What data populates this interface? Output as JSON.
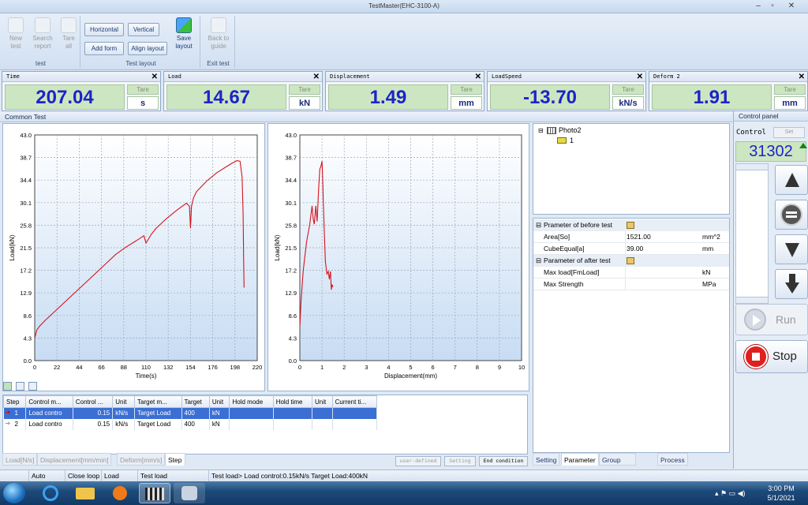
{
  "window": {
    "title": "TestMaster(EHC-3100-A)"
  },
  "ribbon": {
    "test_group": {
      "label": "test",
      "new_test": "New\ntest",
      "search_report": "Search\nreport",
      "tare_all": "Tare\nall"
    },
    "layout_group": {
      "label": "Test layout",
      "horizontal": "Horizontal",
      "vertical": "Vertical",
      "add_form": "Add form",
      "align_layout": "Align layout",
      "save_layout": "Save\nlayout"
    },
    "exit_group": {
      "label": "Exit test",
      "back_to_guide": "Back to\nguide"
    }
  },
  "meters": [
    {
      "title": "Time",
      "value": "207.04",
      "tare": "Tare",
      "unit": "s"
    },
    {
      "title": "Load",
      "value": "14.67",
      "tare": "Tare",
      "unit": "kN"
    },
    {
      "title": "Displacement",
      "value": "1.49",
      "tare": "Tare",
      "unit": "mm"
    },
    {
      "title": "LoadSpeed",
      "value": "-13.70",
      "tare": "Tare",
      "unit": "kN/s"
    },
    {
      "title": "Deform 2",
      "value": "1.91",
      "tare": "Tare",
      "unit": "mm"
    }
  ],
  "common_test": {
    "title": "Common Test"
  },
  "chart_data": [
    {
      "type": "line",
      "xlabel": "Time(s)",
      "ylabel": "Load(kN)",
      "xlim": [
        0,
        220
      ],
      "ylim": [
        0,
        43
      ],
      "xticks": [
        "0",
        "22",
        "44",
        "66",
        "88",
        "110",
        "132",
        "154",
        "176",
        "198",
        "220"
      ],
      "yticks": [
        "0.0",
        "4.3",
        "8.6",
        "12.9",
        "17.2",
        "21.5",
        "25.8",
        "30.1",
        "34.4",
        "38.7",
        "43.0"
      ],
      "grid": true,
      "series": [
        {
          "color": "#d4141c",
          "x": [
            0,
            2,
            5,
            10,
            20,
            30,
            40,
            50,
            60,
            70,
            80,
            90,
            100,
            108,
            110,
            112,
            115,
            120,
            130,
            140,
            150,
            153,
            154,
            155,
            157,
            160,
            170,
            180,
            190,
            195,
            198,
            200,
            203,
            205,
            206,
            206.5,
            207
          ],
          "y": [
            4.3,
            5.8,
            6.6,
            7.6,
            9.4,
            11.2,
            13.0,
            14.8,
            16.6,
            18.4,
            20.2,
            21.6,
            22.8,
            23.8,
            22.4,
            23.0,
            24.0,
            25.2,
            27.0,
            28.6,
            30.0,
            29.4,
            25.2,
            29.4,
            31.0,
            32.2,
            34.2,
            35.8,
            37.0,
            37.6,
            37.9,
            38.1,
            38.0,
            35.0,
            28.0,
            20.0,
            13.9
          ]
        }
      ]
    },
    {
      "type": "line",
      "xlabel": "Displacement(mm)",
      "ylabel": "Load(kN)",
      "xlim": [
        0,
        10
      ],
      "ylim": [
        0,
        43
      ],
      "xticks": [
        "0",
        "1",
        "2",
        "3",
        "4",
        "5",
        "6",
        "7",
        "8",
        "9",
        "10"
      ],
      "yticks": [
        "0.0",
        "4.3",
        "8.6",
        "12.9",
        "17.2",
        "21.5",
        "25.8",
        "30.1",
        "34.4",
        "38.7",
        "43.0"
      ],
      "grid": true,
      "series": [
        {
          "color": "#d4141c",
          "x": [
            0.0,
            0.05,
            0.15,
            0.3,
            0.45,
            0.55,
            0.6,
            0.65,
            0.72,
            0.78,
            0.85,
            0.9,
            0.95,
            1.0,
            1.03,
            1.06,
            1.1,
            1.15,
            1.22,
            1.28,
            1.33,
            1.38,
            1.42,
            1.45,
            1.49
          ],
          "y": [
            6.5,
            11.0,
            17.0,
            22.5,
            26.0,
            29.5,
            27.0,
            26.0,
            29.5,
            26.5,
            33.0,
            36.5,
            37.0,
            38.0,
            35.0,
            30.0,
            25.0,
            19.0,
            16.5,
            17.0,
            15.5,
            17.0,
            13.5,
            14.5,
            14.0
          ]
        }
      ]
    }
  ],
  "step_table": {
    "headers": [
      "Step",
      "Control m...",
      "Control ...",
      "Unit",
      "Target m...",
      "Target",
      "Unit",
      "Hold mode",
      "Hold time",
      "Unit",
      "Current ti..."
    ],
    "rows": [
      [
        "1",
        "Load contro",
        "0.15",
        "kN/s",
        "Target Load",
        "400",
        "kN",
        "",
        "",
        "",
        ""
      ],
      [
        "2",
        "Load contro",
        "0.15",
        "kN/s",
        "Target Load",
        "400",
        "kN",
        "",
        "",
        "",
        ""
      ]
    ]
  },
  "bottom_tabs": [
    "Load[N/s]",
    "Displacement[mm/min]",
    "Deform[mm/s]",
    "Step"
  ],
  "bottom_buttons": {
    "user_defined": "user-defined",
    "setting": "Setting",
    "end_condition": "End condition"
  },
  "tree": {
    "root": "Photo2",
    "child": "1"
  },
  "params": {
    "before_title": "Prameter of before test",
    "before": [
      {
        "name": "Area[So]",
        "value": "1521.00",
        "unit": "mm^2"
      },
      {
        "name": "CubeEqual[a]",
        "value": "39.00",
        "unit": "mm"
      }
    ],
    "after_title": "Parameter of after test",
    "after": [
      {
        "name": "Max load[FmLoad]",
        "value": "",
        "unit": "kN"
      },
      {
        "name": "Max Strength",
        "value": "",
        "unit": "MPa"
      }
    ]
  },
  "param_tabs": [
    "Setting",
    "Parameter",
    "Group parameter",
    "Process"
  ],
  "control_panel": {
    "title": "Control panel",
    "control_label": "Control",
    "set_label": "Set",
    "value": "31302",
    "run": "Run",
    "stop": "Stop"
  },
  "status_bar": [
    "Auto",
    "Close loop",
    "Load",
    "Test load",
    "Test load> Load control:0.15kN/s Target Load:400kN"
  ],
  "taskbar": {
    "time": "3:00 PM",
    "date": "5/1/2021"
  }
}
